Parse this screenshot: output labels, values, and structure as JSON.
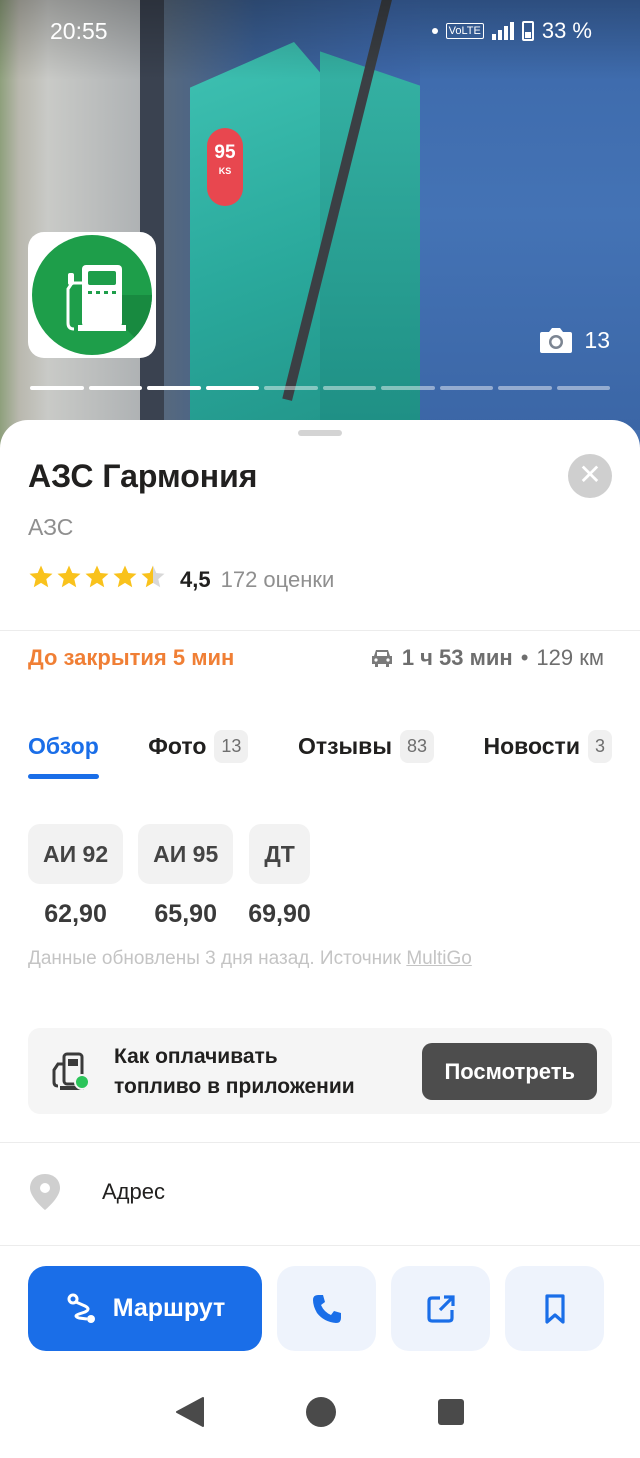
{
  "status_bar": {
    "time": "20:55",
    "volte": "VoLTE",
    "battery": "33 %"
  },
  "gallery": {
    "photo_count": "13",
    "progress_total": 10,
    "progress_done": 4
  },
  "place": {
    "title": "АЗС Гармония",
    "category": "АЗС",
    "rating": "4,5",
    "rating_stars": 4.5,
    "rating_count": "172 оценки"
  },
  "info": {
    "closing": "До закрытия 5 мин",
    "travel_time": "1 ч 53 мин",
    "separator": "•",
    "distance": "129 км"
  },
  "tabs": [
    {
      "label": "Обзор",
      "count": ""
    },
    {
      "label": "Фото",
      "count": "13"
    },
    {
      "label": "Отзывы",
      "count": "83"
    },
    {
      "label": "Новости",
      "count": "3"
    }
  ],
  "fuels": [
    {
      "name": "АИ 92",
      "price": "62,90"
    },
    {
      "name": "АИ 95",
      "price": "65,90"
    },
    {
      "name": "ДТ",
      "price": "69,90"
    }
  ],
  "fuel_update": {
    "text": "Данные обновлены 3 дня назад. Источник ",
    "source": "MultiGo"
  },
  "promo": {
    "line1": "Как оплачивать",
    "line2": "топливо в приложении",
    "button": "Посмотреть"
  },
  "address": {
    "label": "Адрес"
  },
  "actions": {
    "route": "Маршрут"
  },
  "colors": {
    "accent": "#1a6ee8",
    "closing": "#f07f35",
    "brand_green": "#1e9e4a",
    "star": "#f9c21c"
  },
  "icons": [
    "camera-icon",
    "close-icon",
    "star-icon",
    "car-icon",
    "fuel-pay-icon",
    "pin-icon",
    "route-icon",
    "phone-icon",
    "share-icon",
    "bookmark-icon",
    "back-icon",
    "home-icon",
    "recents-icon"
  ]
}
